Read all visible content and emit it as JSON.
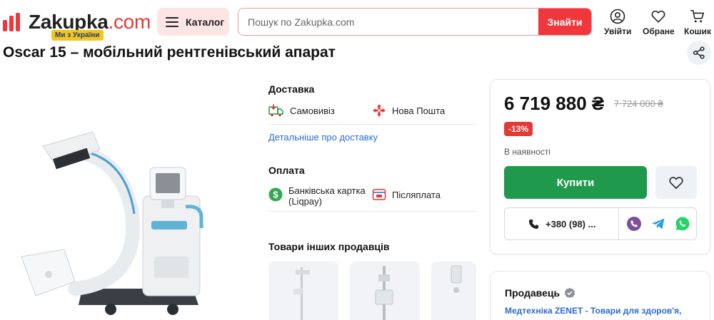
{
  "header": {
    "logo_text": "Zakupka",
    "logo_dotcom": ".com",
    "logo_badge": "Ми з України",
    "catalog_label": "Каталог",
    "search_placeholder": "Пошук по Zakupka.com",
    "search_button": "Знайти",
    "actions": {
      "login": "Увійти",
      "favorites": "Обране",
      "cart": "Кошик"
    }
  },
  "product": {
    "title": "Oscar 15 – мобільний рентгенівський апарат"
  },
  "delivery": {
    "heading": "Доставка",
    "options": [
      "Самовивіз",
      "Нова Пошта"
    ],
    "details_link": "Детальніше про доставку"
  },
  "payment": {
    "heading": "Оплата",
    "options": [
      "Банківська картка (Liqpay)",
      "Післяплата"
    ]
  },
  "other_sellers": {
    "heading": "Товари інших продавців"
  },
  "purchase": {
    "price": "6 719 880 ₴",
    "old_price": "7 724 000 ₴",
    "discount": "-13%",
    "stock": "В наявності",
    "buy_label": "Купити",
    "phone": "+380 (98) ..."
  },
  "seller": {
    "heading": "Продавець",
    "name_link": "Медтехніка ZENET - Товари для здоров'я,"
  },
  "colors": {
    "brand_red": "#f0373c",
    "buy_green": "#1f9a4d",
    "link_blue": "#2d6bcf",
    "discount_red": "#e53935"
  }
}
